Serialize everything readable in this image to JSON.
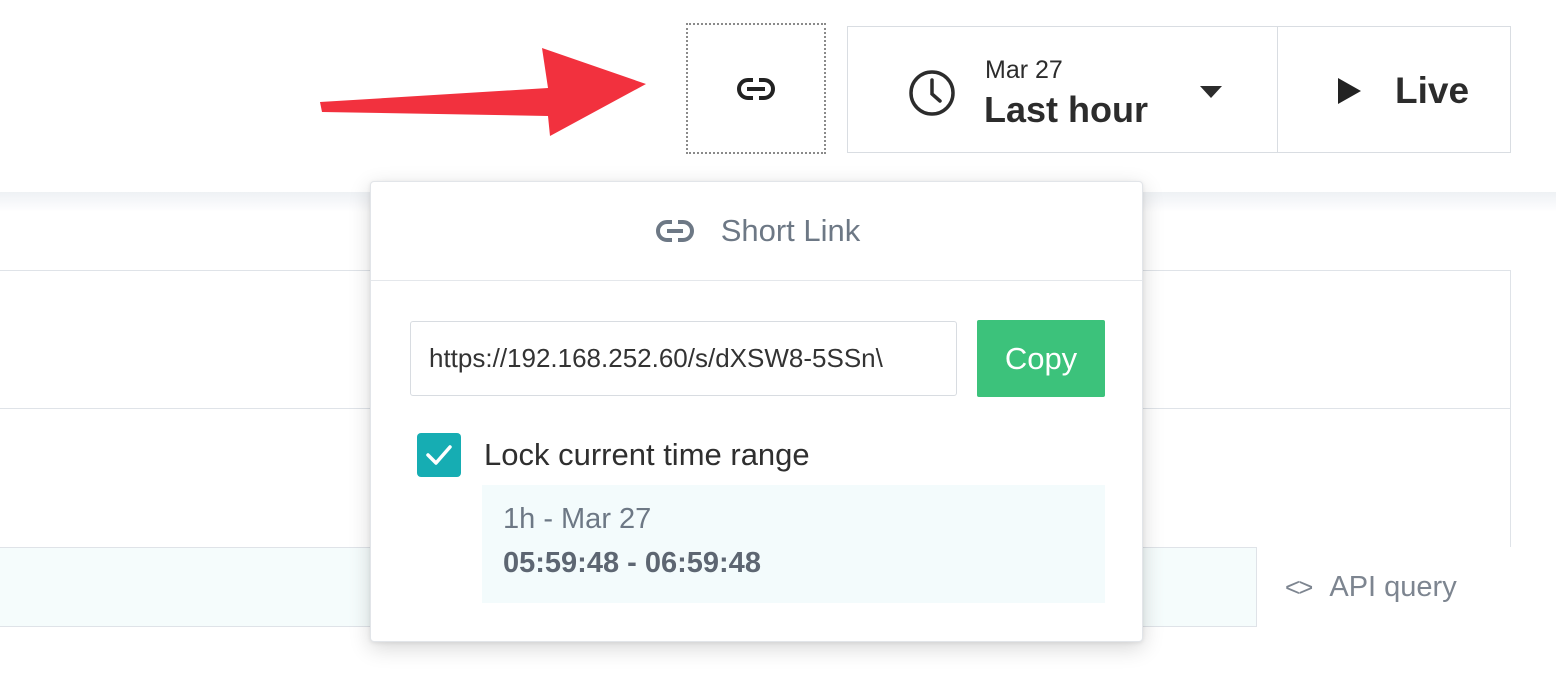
{
  "toolbar": {
    "short_link_button_icon": "link-icon",
    "time_picker": {
      "icon": "clock-icon",
      "date": "Mar 27",
      "label": "Last hour",
      "dropdown_icon": "caret-down-icon"
    },
    "live_button": {
      "icon": "play-icon",
      "label": "Live"
    }
  },
  "annotation": {
    "arrow_color": "#f2313e"
  },
  "popover": {
    "header": {
      "icon": "link-icon",
      "title": "Short Link"
    },
    "url_value": "https://192.168.252.60/s/dXSW8-5SSn\\",
    "copy_label": "Copy",
    "lock_checkbox_checked": true,
    "lock_label": "Lock current time range",
    "range": {
      "line1": "1h - Mar 27",
      "line2": "05:59:48 - 06:59:48"
    }
  },
  "background": {
    "api_query": {
      "icon": "code-icon",
      "label": "API query"
    }
  },
  "colors": {
    "copy_button": "#3cc27b",
    "checkbox": "#16adb3",
    "arrow": "#f2313e",
    "range_box": "#f3fbfc"
  }
}
